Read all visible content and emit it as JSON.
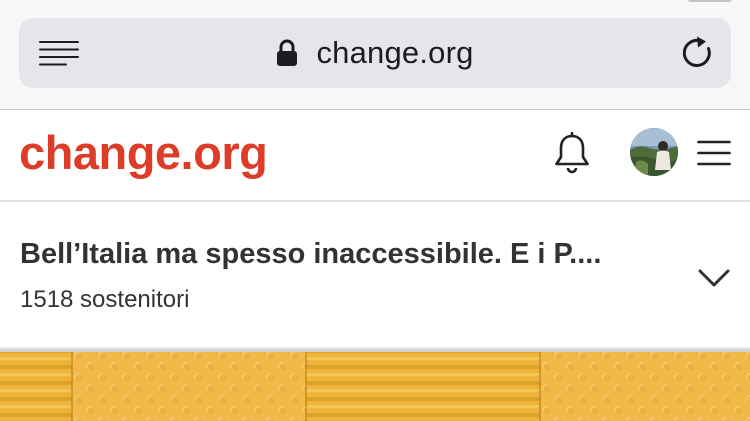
{
  "browser": {
    "url": "change.org",
    "icons": {
      "reader": "reader-view-icon",
      "lock": "lock-icon",
      "reload": "reload-icon"
    }
  },
  "site": {
    "logo_text": "change.org",
    "brand_color": "#dc3c28",
    "icons": {
      "notifications": "bell-icon",
      "avatar": "avatar",
      "menu": "hamburger-menu-icon"
    }
  },
  "petition": {
    "title": "Bell’Italia ma spesso inaccessibile. E i P....",
    "supporters": "1518 sostenitori",
    "expand_icon": "chevron-down-icon"
  },
  "hero": {
    "subject": "yellow tactile paving tiles"
  }
}
